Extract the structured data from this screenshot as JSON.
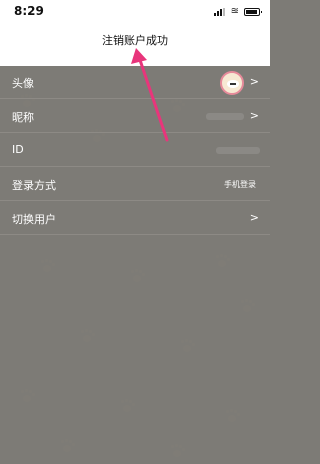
{
  "status_bar": {
    "time": "8:29"
  },
  "toast": {
    "text": "注销账户成功"
  },
  "rows": [
    {
      "label": "头像",
      "value": "",
      "chevron": ">"
    },
    {
      "label": "昵称",
      "value": "",
      "chevron": ">"
    },
    {
      "label": "ID",
      "value": "",
      "chevron": ""
    },
    {
      "label": "登录方式",
      "value": "手机登录",
      "chevron": ""
    },
    {
      "label": "切换用户",
      "value": "",
      "chevron": ">"
    }
  ],
  "annotation": {
    "arrow_color": "#e8357b"
  },
  "colors": {
    "overlay": "#7d7b76",
    "toast_bg": "#ffffff"
  }
}
